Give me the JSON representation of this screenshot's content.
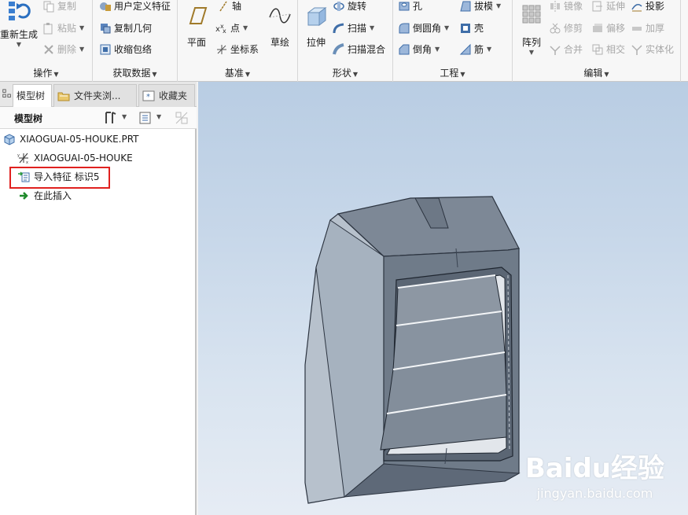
{
  "ribbon": {
    "operations": {
      "label": "操作",
      "regenerate": "重新生成",
      "copy": "复制",
      "paste": "粘贴",
      "delete": "删除"
    },
    "get_data": {
      "label": "获取数据",
      "user_defined_feature": "用户定义特征",
      "copy_geometry": "复制几何",
      "shrinkwrap": "收缩包络"
    },
    "datum": {
      "label": "基准",
      "plane": "平面",
      "axis": "轴",
      "point": "点",
      "csys": "坐标系",
      "sketch": "草绘"
    },
    "shapes": {
      "label": "形状",
      "extrude": "拉伸",
      "revolve": "旋转",
      "sweep": "扫描",
      "swept_blend": "扫描混合"
    },
    "engineering": {
      "label": "工程",
      "hole": "孔",
      "round": "倒圆角",
      "chamfer": "倒角",
      "draft": "拔模",
      "shell": "壳",
      "rib": "筋"
    },
    "editing": {
      "label": "编辑",
      "pattern": "阵列",
      "mirror": "镜像",
      "trim": "修剪",
      "merge": "合并",
      "extend": "延伸",
      "offset": "偏移",
      "intersect": "相交",
      "project": "投影",
      "thicken": "加厚",
      "solidify": "实体化"
    }
  },
  "panel": {
    "tabs": [
      "模型树",
      "文件夹浏...",
      "收藏夹"
    ],
    "tree_title": "模型树",
    "tree": {
      "root": "XIAOGUAI-05-HOUKE.PRT",
      "csys": "XIAOGUAI-05-HOUKE",
      "import_feature": "导入特征 标识5",
      "insert_here": "在此插入"
    }
  },
  "watermark": {
    "top": "Baidu经验",
    "bottom": "jingyan.baidu.com"
  },
  "colors": {
    "highlight": "#e0211f",
    "viewport_top": "#b9cde3",
    "viewport_bottom": "#e6ecf4",
    "model_body": "#6e7a88"
  }
}
